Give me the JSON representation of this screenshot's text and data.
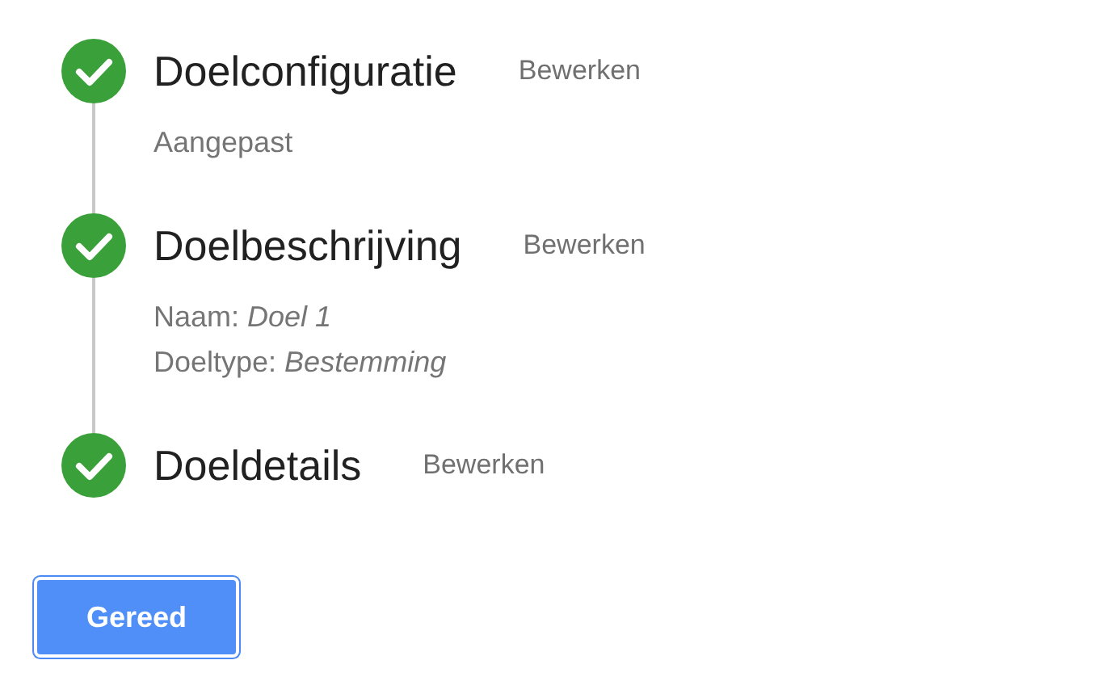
{
  "steps": [
    {
      "title": "Doelconfiguratie",
      "edit_label": "Bewerken",
      "completed": true,
      "details": [
        "Aangepast"
      ]
    },
    {
      "title": "Doelbeschrijving",
      "edit_label": "Bewerken",
      "completed": true,
      "details": [
        "Naam: *Doel 1*",
        "Doeltype: *Bestemming*"
      ]
    },
    {
      "title": "Doeldetails",
      "edit_label": "Bewerken",
      "completed": true
    }
  ],
  "done_button": {
    "label": "Gereed"
  }
}
